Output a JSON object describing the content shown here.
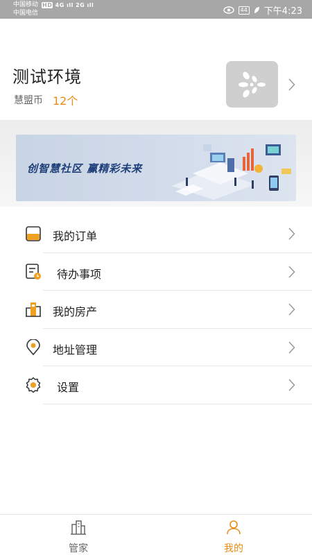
{
  "status_bar": {
    "carrier_1": "中国移动",
    "carrier_2": "中国电信",
    "network_1": "HD",
    "network_2": "4G",
    "network_3": "2G",
    "battery": "44",
    "time": "下午4:23"
  },
  "profile": {
    "name": "测试环境",
    "coin_label": "慧盟币",
    "coin_value": "12个"
  },
  "banner": {
    "slogan": "创智慧社区  赢精彩未来"
  },
  "menu": [
    {
      "label": "我的订单",
      "icon": "order-icon"
    },
    {
      "label": "待办事项",
      "icon": "todo-icon"
    },
    {
      "label": "我的房产",
      "icon": "property-icon"
    },
    {
      "label": "地址管理",
      "icon": "location-icon"
    },
    {
      "label": "设置",
      "icon": "gear-icon"
    }
  ],
  "bottom_nav": {
    "tabs": [
      {
        "label": "管家",
        "icon": "building-icon",
        "active": false
      },
      {
        "label": "我的",
        "icon": "user-icon",
        "active": true
      }
    ]
  },
  "colors": {
    "accent": "#e98c13",
    "status_bar": "#a7a7a7",
    "banner_text": "#1f3f7a"
  }
}
